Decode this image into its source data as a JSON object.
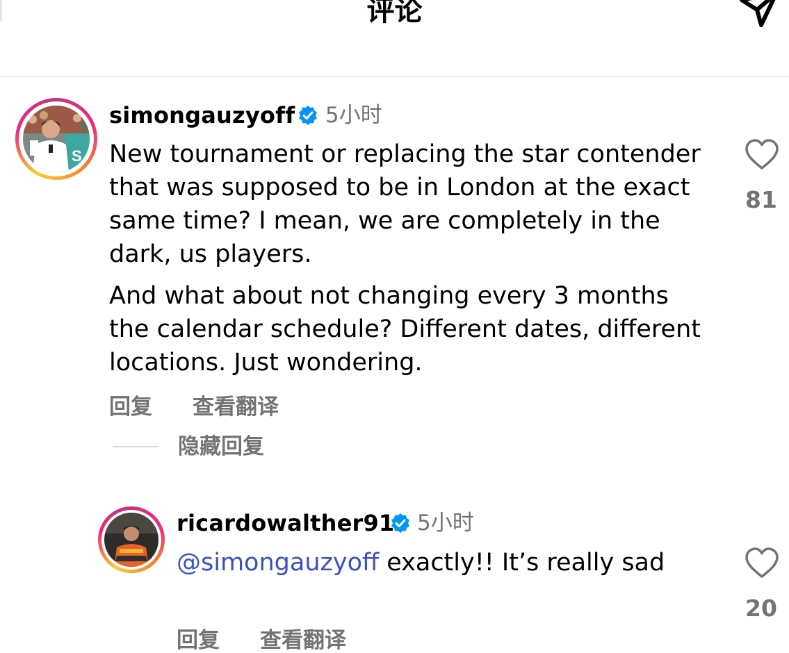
{
  "header": {
    "title": "评论"
  },
  "comments": [
    {
      "username": "simongauzyoff",
      "time": "5小时",
      "paragraphs": [
        "New tournament or replacing the star contender that was supposed to be in London at the exact same time? I mean, we are completely in the dark, us players.",
        "And what about not changing every 3 months the calendar schedule? Different dates, different locations. Just wondering."
      ],
      "likes": "81",
      "reply_label": "回复",
      "translate_label": "查看翻译",
      "hide_replies_label": "隐藏回复"
    },
    {
      "username": "ricardowalther91",
      "time": "5小时",
      "mention": "@simongauzyoff",
      "text": " exactly!! It’s really sad",
      "likes": "20",
      "reply_label": "回复",
      "translate_label": "查看翻译"
    }
  ],
  "colors": {
    "mention": "#3b50c8",
    "verified": "#0095f6",
    "secondary_text": "#737373"
  }
}
